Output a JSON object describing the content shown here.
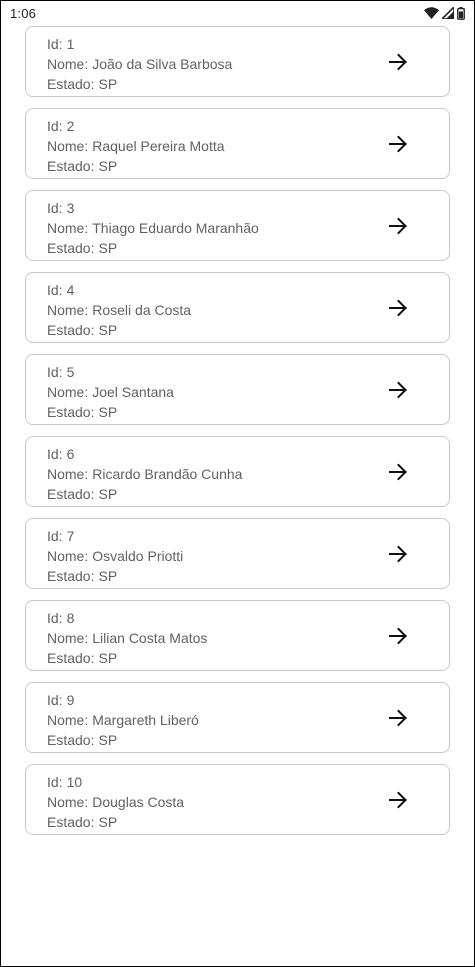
{
  "status_bar": {
    "time": "1:06",
    "icons": [
      "wifi-icon",
      "cell-signal-icon",
      "battery-icon"
    ]
  },
  "labels": {
    "id": "Id:",
    "name": "Nome:",
    "state": "Estado:"
  },
  "items": [
    {
      "id": "1",
      "name": "João da Silva Barbosa",
      "state": "SP"
    },
    {
      "id": "2",
      "name": "Raquel Pereira Motta",
      "state": "SP"
    },
    {
      "id": "3",
      "name": "Thiago Eduardo Maranhão",
      "state": "SP"
    },
    {
      "id": "4",
      "name": "Roseli da Costa",
      "state": "SP"
    },
    {
      "id": "5",
      "name": "Joel Santana",
      "state": "SP"
    },
    {
      "id": "6",
      "name": "Ricardo Brandão Cunha",
      "state": "SP"
    },
    {
      "id": "7",
      "name": "Osvaldo Priotti",
      "state": "SP"
    },
    {
      "id": "8",
      "name": "Lilian Costa Matos",
      "state": "SP"
    },
    {
      "id": "9",
      "name": "Margareth Liberó",
      "state": "SP"
    },
    {
      "id": "10",
      "name": "Douglas Costa",
      "state": "SP"
    }
  ],
  "item_icon": "arrow-right-icon",
  "colors": {
    "card_border": "#c9c9c9",
    "text": "#616161",
    "icon": "#111111"
  }
}
